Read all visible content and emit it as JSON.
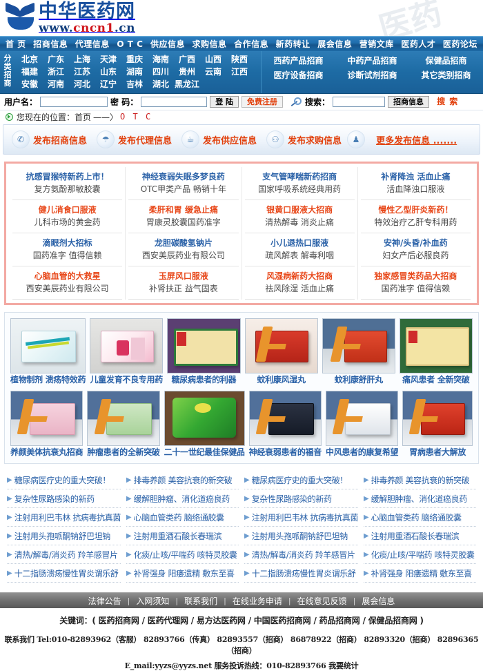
{
  "site": {
    "logo_cn": "中华医药网",
    "logo_url_pre": "www.",
    "logo_url_mid": "cncn1",
    "logo_url_post": ".cn",
    "watermark": "医药"
  },
  "topnav": [
    {
      "label": "首 页"
    },
    {
      "label": "招商信息"
    },
    {
      "label": "代理信息"
    },
    {
      "label": "O T C"
    },
    {
      "label": "供应信息"
    },
    {
      "label": "求购信息"
    },
    {
      "label": "合作信息"
    },
    {
      "label": "新药转让"
    },
    {
      "label": "展会信息"
    },
    {
      "label": "营销文库"
    },
    {
      "label": "医药人才"
    },
    {
      "label": "医药论坛"
    }
  ],
  "band": {
    "label": "分类招商",
    "provinces": [
      [
        "北京",
        "广东",
        "上海",
        "天津",
        "重庆",
        "海南",
        "广西",
        "山西",
        "陕西"
      ],
      [
        "福建",
        "浙江",
        "江苏",
        "山东",
        "湖南",
        "四川",
        "贵州",
        "云南",
        "江西"
      ],
      [
        "安徽",
        "河南",
        "河北",
        "辽宁",
        "吉林",
        "湖北",
        "黑龙江"
      ]
    ],
    "categories": [
      [
        "西药产品招商",
        "中药产品招商",
        "保健品招商"
      ],
      [
        "医疗设备招商",
        "诊断试剂招商",
        "其它类别招商"
      ]
    ]
  },
  "login": {
    "user_label": "用户名：",
    "user_value": "",
    "pass_label": "密 码：",
    "pass_value": "",
    "login_button": "登 陆",
    "register_button": "免费注册",
    "search_icon": "search-icon",
    "search_label": "搜索：",
    "search_value": "",
    "search_scope_button": "招商信息",
    "search_button": "搜 索"
  },
  "breadcrumb": {
    "prefix": "您现在的位置：",
    "home": "首页",
    "arrow": "——〉",
    "current": "O T C"
  },
  "publish": {
    "items": [
      {
        "icon": "phone-icon",
        "glyph": "✆",
        "label": "发布招商信息"
      },
      {
        "icon": "cloud-icon",
        "glyph": "☂",
        "label": "发布代理信息"
      },
      {
        "icon": "cup-icon",
        "glyph": "☕",
        "label": "发布供应信息"
      },
      {
        "icon": "people-icon",
        "glyph": "⚇",
        "label": "发布求购信息"
      },
      {
        "icon": "bag-icon",
        "glyph": "♟",
        "label": ""
      }
    ],
    "more": "更多发布信息 ......."
  },
  "promo": {
    "columns": [
      [
        {
          "title": "抗感冒猴特新药上市！",
          "title_color": "blue",
          "sub": "复方氨酚那敏胶囊"
        },
        {
          "title": "健儿消食口服液",
          "title_color": "red",
          "sub": "儿科市场的黄金药"
        },
        {
          "title": "滴眼剂大招标",
          "title_color": "blue",
          "sub": "国药准字 值得信赖"
        },
        {
          "title": "心脑血管的大救星",
          "title_color": "red",
          "sub": "西安美辰药业有限公司"
        }
      ],
      [
        {
          "title": "神经衰弱失眠多梦良药",
          "title_color": "blue",
          "sub": "OTC甲类产品 畅销十年"
        },
        {
          "title": "柔肝和胃 缓急止痛",
          "title_color": "red",
          "sub": "胃康灵胶囊国药准字"
        },
        {
          "title": "龙胆碳酸氢钠片",
          "title_color": "blue",
          "sub": "西安美辰药业有限公司"
        },
        {
          "title": "玉屏风口服液",
          "title_color": "red",
          "sub": "补肾扶正 益气固表"
        }
      ],
      [
        {
          "title": "支气管哮喘新药招商",
          "title_color": "blue",
          "sub": "国家呼吸系统经典用药"
        },
        {
          "title": "银黄口服液大招商",
          "title_color": "red",
          "sub": "清热解毒 消炎止痛"
        },
        {
          "title": "小儿退热口服液",
          "title_color": "blue",
          "sub": "疏风解表 解毒利咽"
        },
        {
          "title": "风湿病新药大招商",
          "title_color": "red",
          "sub": "祛风除湿 活血止痛"
        }
      ],
      [
        {
          "title": "补肾降浊 活血止痛",
          "title_color": "blue",
          "sub": "活血降浊口服液"
        },
        {
          "title": "慢性乙型肝炎新药！",
          "title_color": "red",
          "sub": "特效治疗乙肝专科用药"
        },
        {
          "title": "安神/头昏/补血药",
          "title_color": "blue",
          "sub": "妇女产后必服良药"
        },
        {
          "title": "独家感冒类药品大招商",
          "title_color": "red",
          "sub": "国药准字 值得信赖"
        }
      ]
    ]
  },
  "gallery": {
    "rows": [
      [
        {
          "caption": "植物制剂 溃疡特效药",
          "style": "pack-teal"
        },
        {
          "caption": "儿童发育不良专用药",
          "style": "pack-pink"
        },
        {
          "caption": "糖尿病患者的利器",
          "style": "pack-yellow"
        },
        {
          "caption": "蚊利康风湿丸",
          "style": "pack-leanred"
        },
        {
          "caption": "蚊利康舒肝丸",
          "style": "pack-leanred2"
        },
        {
          "caption": "痛风患者 全新突破",
          "style": "pack-yellow2"
        }
      ],
      [
        {
          "caption": "养颜美体抗衰丸招商",
          "style": "pack-leanpink"
        },
        {
          "caption": "肿瘤患者的全新突破",
          "style": "pack-leangreen"
        },
        {
          "caption": "二十一世纪最佳保健品",
          "style": "pack-greenbag"
        },
        {
          "caption": "神经衰弱患者的福音",
          "style": "pack-leandark"
        },
        {
          "caption": "中风患者的康复希望",
          "style": "pack-leanwhite"
        },
        {
          "caption": "胃病患者大解放",
          "style": "pack-leanred3"
        }
      ]
    ]
  },
  "links": {
    "columns": [
      [
        "糖尿病医疗史的重大突破！",
        "复杂性尿路感染的新药",
        "注射用利巴韦林 抗病毒抗真菌",
        "注射用头孢哌酮钠舒巴坦钠",
        "清热/解毒/消炎药 羚羊感冒片",
        "十二指肠溃疡慢性胃炎谓乐舒"
      ],
      [
        "排毒养颜 美容抗衰的新突破",
        "缓解胆肿瘤、消化道癌良药",
        "心脑血管类药 脑络通胶囊",
        "注射用重酒石酸长春瑞滨",
        "化痰/止咳/平喘药 咳特灵胶囊",
        "补肾强身 阳痿遗精 敷东至喜"
      ],
      [
        "糖尿病医疗史的重大突破！",
        "复杂性尿路感染的新药",
        "注射用利巴韦林 抗病毒抗真菌",
        "注射用头孢哌酮钠舒巴坦钠",
        "清热/解毒/消炎药 羚羊感冒片",
        "十二指肠溃疡慢性胃炎谓乐舒"
      ],
      [
        "排毒养颜 美容抗衰的新突破",
        "缓解胆肿瘤、消化道癌良药",
        "心脑血管类药 脑络通胶囊",
        "注射用重酒石酸长春瑞滨",
        "化痰/止咳/平喘药 咳特灵胶囊",
        "补肾强身 阳痿遗精 敷东至喜"
      ]
    ]
  },
  "footer": {
    "nav": [
      "法律公告",
      "入网须知",
      "联系我们",
      "在线业务申请",
      "在线意见反馈",
      "展会信息"
    ],
    "keywords": "关键词：( 医药招商网 / 医药代理网 / 易方达医药网 / 中国医药招商网 / 药品招商网 / 保健品招商网 )",
    "contact": "联系我们 Tel:010-82893962（客服） 82893766（传真） 82893557（招商） 86878922（招商） 82893320（招商） 82896365（招商）",
    "mail": "E_mail:yyzs@yyzs.net 服务投诉热线：010-82893766 我要统计"
  },
  "colors": {
    "nav_blue": "#1f6ead",
    "band_blue": "#1d6ba4",
    "accent_red": "#e2400c",
    "link_blue": "#2b62a8",
    "promo_border": "#f3a9a3",
    "footer_gray": "#6f6f6f"
  }
}
